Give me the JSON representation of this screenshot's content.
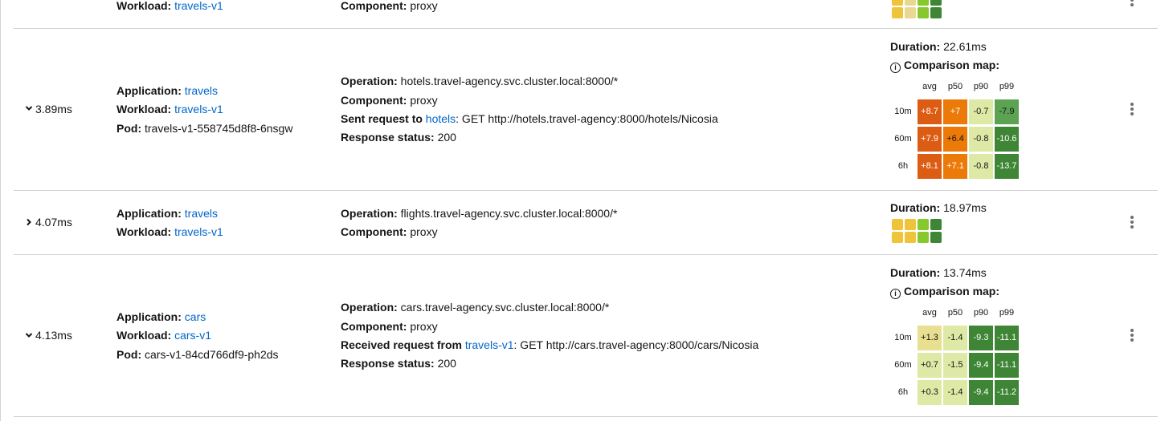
{
  "rows": [
    {
      "partial": true,
      "workload_label": "Workload:",
      "workload": "travels-v1",
      "component_label": "Component:",
      "component": "proxy",
      "mini_colors": [
        "#f0c43a",
        "#e8d891",
        "#87c82c",
        "#3e8635",
        "#f0c43a",
        "#e8d891",
        "#87c82c",
        "#3e8635"
      ]
    },
    {
      "expanded": true,
      "duration_short": "3.89ms",
      "application_label": "Application:",
      "application": "travels",
      "workload_label": "Workload:",
      "workload": "travels-v1",
      "pod_label": "Pod:",
      "pod": "travels-v1-558745d8f8-6nsgw",
      "operation_label": "Operation:",
      "operation": "hotels.travel-agency.svc.cluster.local:8000/*",
      "component_label": "Component:",
      "component": "proxy",
      "request_label": "Sent request to",
      "request_target": "hotels",
      "request_detail": ": GET http://hotels.travel-agency:8000/hotels/Nicosia",
      "status_label": "Response status:",
      "status": "200",
      "duration_label": "Duration:",
      "duration": "22.61ms",
      "comparison_title": "Comparison map:",
      "heatmap": {
        "cols": [
          "avg",
          "p50",
          "p90",
          "p99"
        ],
        "rows": [
          "10m",
          "60m",
          "6h"
        ],
        "values": [
          [
            "+8.7",
            "+7",
            "-0.7",
            "-7.9"
          ],
          [
            "+7.9",
            "+6.4",
            "-0.8",
            "-10.6"
          ],
          [
            "+8.1",
            "+7.1",
            "-0.8",
            "-13.7"
          ]
        ],
        "colors": [
          [
            "#dd5c13",
            "#ec7a08",
            "#dde9a5",
            "#5ba352"
          ],
          [
            "#dd5c13",
            "#ec7a08",
            "#dde9a5",
            "#3e8635"
          ],
          [
            "#dd5c13",
            "#ec7a08",
            "#dde9a5",
            "#3e8635"
          ]
        ],
        "text_colors": [
          [
            "#fff",
            "#fff",
            "#151515",
            "#151515"
          ],
          [
            "#fff",
            "#151515",
            "#151515",
            "#fff"
          ],
          [
            "#fff",
            "#fff",
            "#151515",
            "#fff"
          ]
        ]
      }
    },
    {
      "expanded": false,
      "duration_short": "4.07ms",
      "application_label": "Application:",
      "application": "travels",
      "workload_label": "Workload:",
      "workload": "travels-v1",
      "operation_label": "Operation:",
      "operation": "flights.travel-agency.svc.cluster.local:8000/*",
      "component_label": "Component:",
      "component": "proxy",
      "duration_label": "Duration:",
      "duration": "18.97ms",
      "mini_colors": [
        "#f0c43a",
        "#f0c43a",
        "#87c82c",
        "#3e8635",
        "#f0c43a",
        "#f0c43a",
        "#87c82c",
        "#3e8635"
      ]
    },
    {
      "expanded": true,
      "duration_short": "4.13ms",
      "application_label": "Application:",
      "application": "cars",
      "workload_label": "Workload:",
      "workload": "cars-v1",
      "pod_label": "Pod:",
      "pod": "cars-v1-84cd766df9-ph2ds",
      "operation_label": "Operation:",
      "operation": "cars.travel-agency.svc.cluster.local:8000/*",
      "component_label": "Component:",
      "component": "proxy",
      "request_label": "Received request from",
      "request_target": "travels-v1",
      "request_detail": ": GET http://cars.travel-agency:8000/cars/Nicosia",
      "status_label": "Response status:",
      "status": "200",
      "duration_label": "Duration:",
      "duration": "13.74ms",
      "comparison_title": "Comparison map:",
      "heatmap": {
        "cols": [
          "avg",
          "p50",
          "p90",
          "p99"
        ],
        "rows": [
          "10m",
          "60m",
          "6h"
        ],
        "values": [
          [
            "+1.3",
            "-1.4",
            "-9.3",
            "-11.1"
          ],
          [
            "+0.7",
            "-1.5",
            "-9.4",
            "-11.1"
          ],
          [
            "+0.3",
            "-1.4",
            "-9.4",
            "-11.2"
          ]
        ],
        "colors": [
          [
            "#e8df91",
            "#dde9a5",
            "#3e8635",
            "#3e8635"
          ],
          [
            "#dde9a5",
            "#dde9a5",
            "#3e8635",
            "#3e8635"
          ],
          [
            "#dde9a5",
            "#dde9a5",
            "#3e8635",
            "#3e8635"
          ]
        ],
        "text_colors": [
          [
            "#151515",
            "#151515",
            "#fff",
            "#fff"
          ],
          [
            "#151515",
            "#151515",
            "#fff",
            "#fff"
          ],
          [
            "#151515",
            "#151515",
            "#fff",
            "#fff"
          ]
        ]
      }
    }
  ]
}
